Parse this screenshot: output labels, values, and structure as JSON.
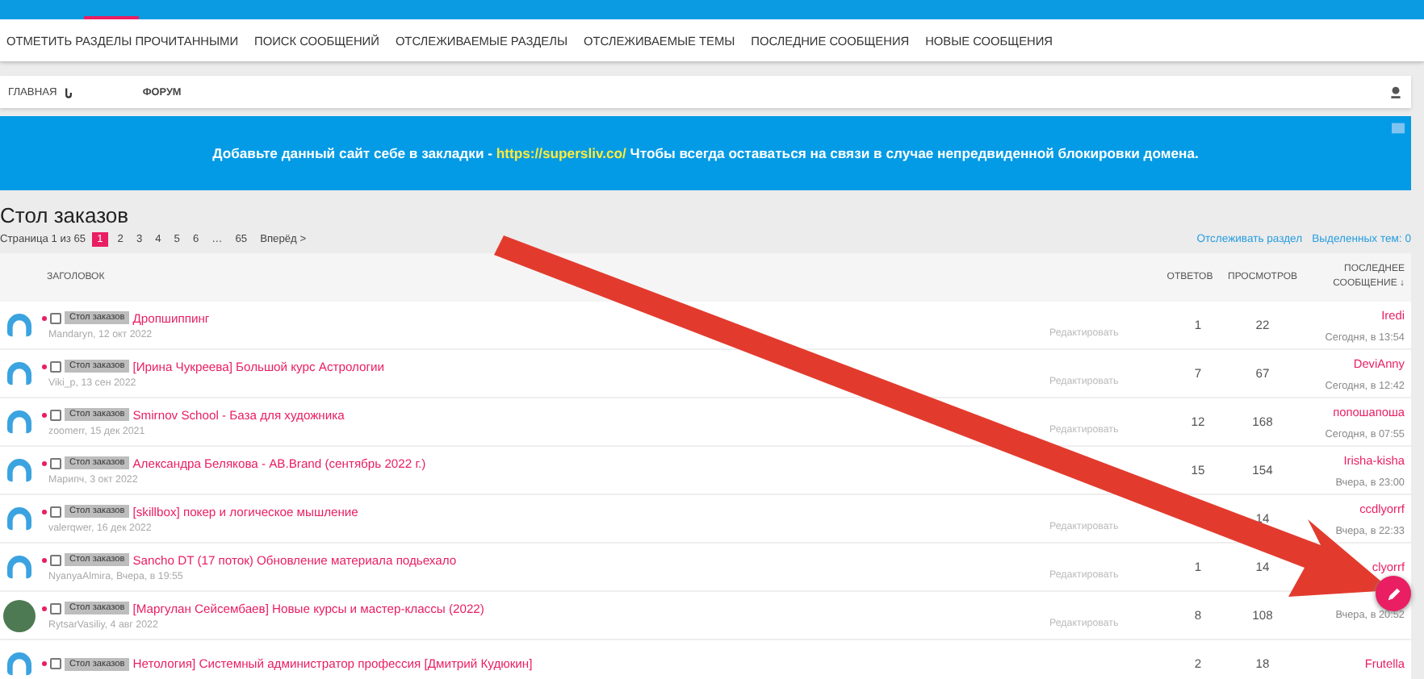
{
  "subnav": {
    "items": [
      "ОТМЕТИТЬ РАЗДЕЛЫ ПРОЧИТАННЫМИ",
      "ПОИСК СООБЩЕНИЙ",
      "ОТСЛЕЖИВАЕМЫЕ РАЗДЕЛЫ",
      "ОТСЛЕЖИВАЕМЫЕ ТЕМЫ",
      "ПОСЛЕДНИЕ СООБЩЕНИЯ",
      "НОВЫЕ СООБЩЕНИЯ"
    ]
  },
  "breadcrumb": [
    "ГЛАВНАЯ",
    "ФОРУМ"
  ],
  "banner": {
    "before": "Добавьте данный сайт себе в закладки - ",
    "link": "https://supersliv.co/",
    "after": " Чтобы всегда оставаться на связи в случае непредвиденной блокировки домена."
  },
  "page_title": "Стол заказов",
  "pagination": {
    "label": "Страница 1 из 65",
    "pages": [
      {
        "label": "1",
        "selected": true
      },
      {
        "label": "2",
        "selected": false
      },
      {
        "label": "3",
        "selected": false
      },
      {
        "label": "4",
        "selected": false
      },
      {
        "label": "5",
        "selected": false
      },
      {
        "label": "6",
        "selected": false
      }
    ],
    "ellipsis": "…",
    "last": "65",
    "next": "Вперёд >"
  },
  "actions": [
    "Отслеживать раздел",
    "Выделенных тем: 0"
  ],
  "table": {
    "columns": [
      "ЗАГОЛОВОК",
      "ОТВЕТОВ",
      "ПРОСМОТРОВ",
      "ПОСЛЕДНЕЕ СООБЩЕНИЕ ↓"
    ],
    "rows": [
      {
        "kind": "silhouette",
        "checked": false,
        "tag": "Стол заказов",
        "title": "Дропшиппинг",
        "author": "Mandaryn,",
        "date": "12 окт 2022",
        "edit": "Редактировать",
        "replies": "1",
        "views": "22",
        "last_user": "Iredi",
        "last_time": "Сегодня, в 13:54"
      },
      {
        "kind": "silhouette",
        "checked": false,
        "tag": "Стол заказов",
        "title": "[Ирина Чукреева] Большой курс Астрологии",
        "author": "Viki_p,",
        "date": "13 сен 2022",
        "edit": "Редактировать",
        "replies": "7",
        "views": "67",
        "last_user": "DeviAnny",
        "last_time": "Сегодня, в 12:42"
      },
      {
        "kind": "silhouette",
        "checked": false,
        "tag": "Стол заказов",
        "title": "Smirnov School - База для художника",
        "author": "zoomerr,",
        "date": "15 дек 2021",
        "edit": "Редактировать",
        "replies": "12",
        "views": "168",
        "last_user": "попошапоша",
        "last_time": "Сегодня, в 07:55"
      },
      {
        "kind": "silhouette",
        "checked": false,
        "tag": "Стол заказов",
        "title": "Александра Белякова - AB.Brand (сентябрь 2022 г.)",
        "author": "Марипч,",
        "date": "3 окт 2022",
        "replies": "15",
        "views": "154",
        "last_user": "Irisha-kisha",
        "last_time": "Вчера, в 23:00"
      },
      {
        "kind": "silhouette",
        "checked": false,
        "tag": "Стол заказов",
        "title": "[skillbox] покер и логическое мышление",
        "author": "valerqwer,",
        "date": "16 дек 2022",
        "edit": "Редактировать",
        "views": "14",
        "last_user": "ccdlyorrf",
        "last_time": "Вчера, в 22:33"
      },
      {
        "kind": "silhouette",
        "checked": false,
        "tag": "Стол заказов",
        "title": "Sancho DT (17 поток) Обновление материала подьехало",
        "author": "NyanyaAlmira,",
        "date": "Вчера, в 19:55",
        "edit": "Редактировать",
        "replies": "1",
        "views": "14",
        "last_user": "clyorrf"
      },
      {
        "kind": "photo",
        "checked": false,
        "tag": "Стол заказов",
        "title": "[Маргулан Сейсембаев] Новые курсы и мастер-классы (2022)",
        "author": "RytsarVasiliy,",
        "date": "4 авг 2022",
        "edit": "Редактировать",
        "replies": "8",
        "views": "108",
        "last_time": "Вчера, в 20:52"
      },
      {
        "kind": "silhouette",
        "checked": false,
        "tag": "Стол заказов",
        "title": "Нетология] Системный администратор профессия [Дмитрий Кудюкин]",
        "replies": "2",
        "views": "18",
        "last_user": "Frutella"
      }
    ]
  }
}
